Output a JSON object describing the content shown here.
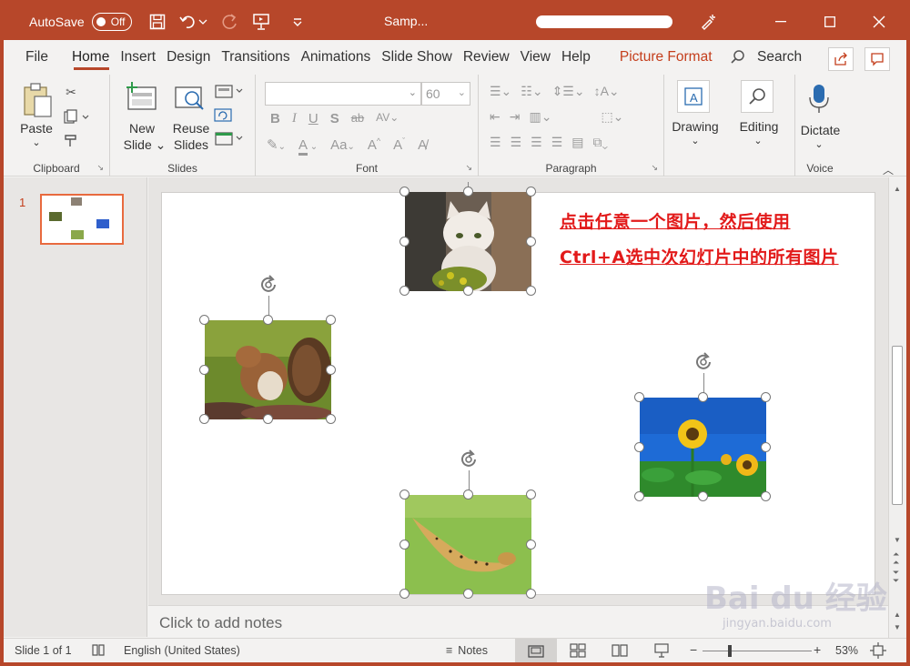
{
  "titlebar": {
    "autosave_label": "AutoSave",
    "autosave_state": "Off",
    "doc_title": "Samp..."
  },
  "menu": {
    "items": [
      "File",
      "Home",
      "Insert",
      "Design",
      "Transitions",
      "Animations",
      "Slide Show",
      "Review",
      "View",
      "Help",
      "Picture Format"
    ],
    "search": "Search"
  },
  "ribbon": {
    "clipboard": {
      "paste": "Paste",
      "label": "Clipboard"
    },
    "slides": {
      "new_slide_1": "New",
      "new_slide_2": "Slide",
      "reuse_1": "Reuse",
      "reuse_2": "Slides",
      "label": "Slides"
    },
    "font": {
      "size": "60",
      "label": "Font"
    },
    "paragraph": {
      "label": "Paragraph"
    },
    "drawing": "Drawing",
    "editing": "Editing",
    "dictate": "Dictate",
    "voice_label": "Voice"
  },
  "thumbpane": {
    "slide_number": "1"
  },
  "slide": {
    "annotation_line1": "点击任意一个图片，然后使用",
    "annotation_line2": "Ctrl+A选中次幻灯片中的所有图片"
  },
  "notes": {
    "placeholder": "Click to add notes"
  },
  "status": {
    "slide_info": "Slide 1 of 1",
    "language": "English (United States)",
    "notes": "Notes",
    "zoom": "53%"
  },
  "watermark": {
    "main": "Bai du 经验",
    "sub": "jingyan.baidu.com"
  },
  "colors": {
    "accent": "#b7472a",
    "annotation": "#e21a1a"
  }
}
